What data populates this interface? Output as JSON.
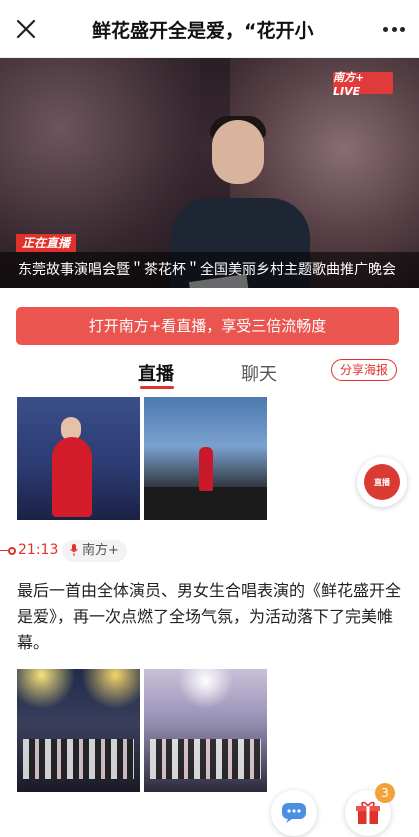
{
  "header": {
    "title": "鲜花盛开全是爱，“花开小",
    "close_icon": "close-icon",
    "more_icon": "more-icon"
  },
  "video": {
    "badge": "南方+ LIVE",
    "live_tag": "正在直播",
    "caption": "东莞故事演唱会暨＂茶花杯＂全国美丽乡村主题歌曲推广晚会"
  },
  "open_app_button": "打开南方+看直播，享受三倍流畅度",
  "tabs": [
    {
      "label": "直播",
      "active": true
    },
    {
      "label": "聊天",
      "active": false
    }
  ],
  "share_button": "分享海报",
  "floating_radio_label": "直播",
  "timeline": {
    "time": "21:13",
    "source": "南方+"
  },
  "post_text": "最后一首由全体演员、男女生合唱表演的《鲜花盛开全是爱》，再一次点燃了全场气氛，为活动落下了完美帷幕。",
  "gift_count": "3",
  "colors": {
    "accent_red": "#e0312c",
    "button_red": "#ea5550",
    "badge_orange": "#f0a33b"
  }
}
